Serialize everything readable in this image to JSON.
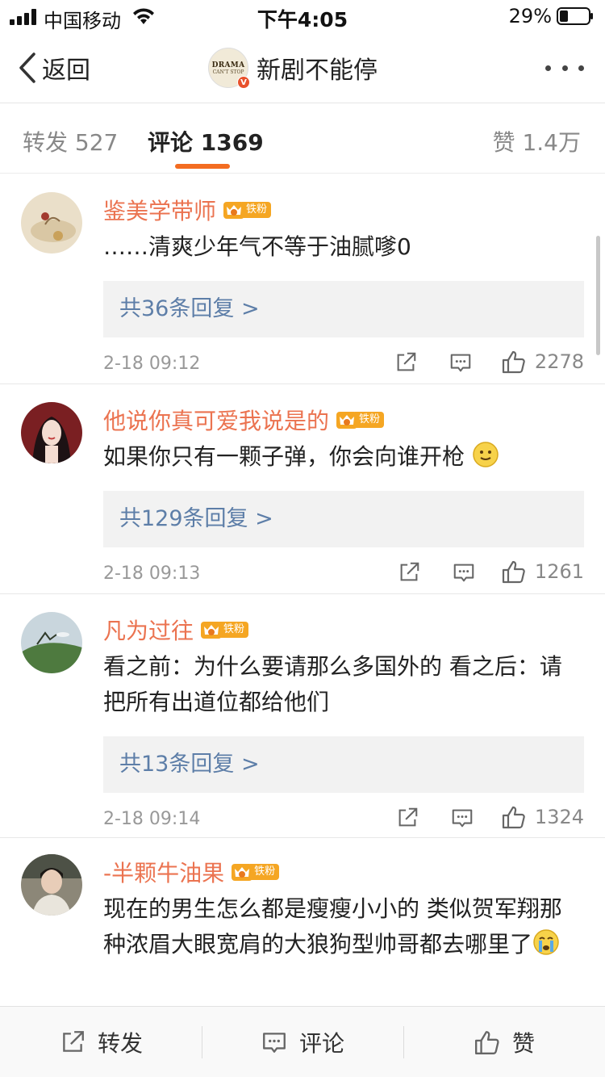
{
  "status_bar": {
    "carrier": "中国移动",
    "time": "下午4:05",
    "battery": "29%"
  },
  "nav": {
    "back_label": "返回",
    "title": "新剧不能停",
    "avatar_line1": "DRAMA",
    "avatar_line2": "CAN'T STOP",
    "verified_mark": "V"
  },
  "tabs": {
    "repost": "转发 527",
    "comment": "评论 1369",
    "like": "赞 1.4万"
  },
  "comments": [
    {
      "name": "鉴美学带师",
      "fan_label": "铁粉",
      "text": "……清爽少年气不等于油腻嗲0",
      "replies": "共36条回复 >",
      "time": "2-18 09:12",
      "likes": "2278"
    },
    {
      "name": "他说你真可爱我说是的",
      "fan_label": "铁粉",
      "text": "如果你只有一颗子弹，你会向谁开枪",
      "replies": "共129条回复 >",
      "time": "2-18 09:13",
      "likes": "1261"
    },
    {
      "name": "凡为过往",
      "fan_label": "铁粉",
      "text": "看之前：为什么要请那么多国外的 看之后：请把所有出道位都给他们",
      "replies": "共13条回复 >",
      "time": "2-18 09:14",
      "likes": "1324"
    },
    {
      "name": "-半颗牛油果",
      "fan_label": "铁粉",
      "text": "现在的男生怎么都是瘦瘦小小的 类似贺军翔那种浓眉大眼宽肩的大狼狗型帅哥都去哪里了"
    }
  ],
  "bottom_bar": {
    "repost": "转发",
    "comment": "评论",
    "like": "赞"
  },
  "colors": {
    "accent": "#f36c21",
    "username": "#eb7350",
    "reply_link": "#5d7ea8",
    "fan_badge": "#f5a623"
  }
}
